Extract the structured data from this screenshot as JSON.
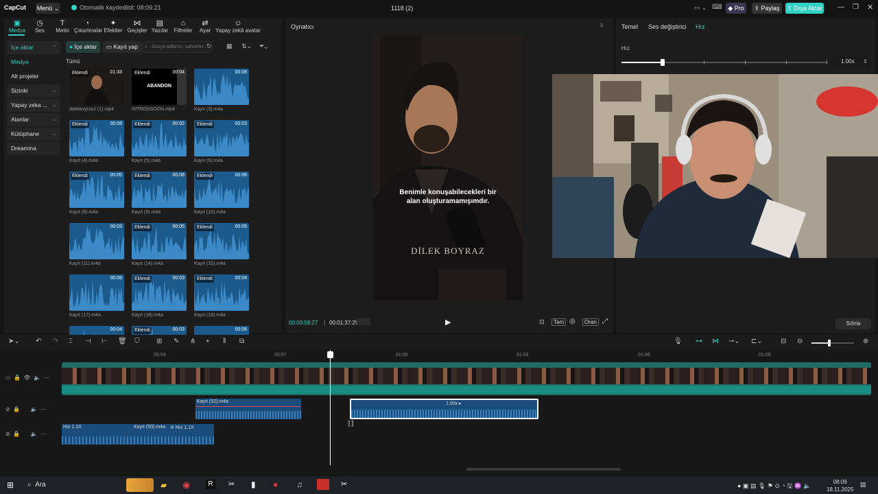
{
  "app": {
    "logo": "CapCut",
    "menu_label": "Menü",
    "autosave": "Otomatik kaydedildi: 08:09:21",
    "project_title": "1118 (2)",
    "pro_label": "Pro",
    "share_label": "Paylaş",
    "export_label": "Dışa Aktar",
    "accent_color": "#2fd1c4"
  },
  "media_tabs": [
    {
      "label": "Medya",
      "icon": "media-icon",
      "glyph": "▣",
      "active": true
    },
    {
      "label": "Ses",
      "icon": "audio-icon",
      "glyph": "◷"
    },
    {
      "label": "Metin",
      "icon": "text-icon",
      "glyph": "T"
    },
    {
      "label": "Çıkartmalar",
      "icon": "sticker-icon",
      "glyph": "◔"
    },
    {
      "label": "Efektler",
      "icon": "effects-icon",
      "glyph": "✦"
    },
    {
      "label": "Geçişler",
      "icon": "transitions-icon",
      "glyph": "⋈"
    },
    {
      "label": "Yazılar",
      "icon": "captions-icon",
      "glyph": "▤"
    },
    {
      "label": "Filtreler",
      "icon": "filters-icon",
      "glyph": "⌂"
    },
    {
      "label": "Ayar",
      "icon": "adjust-icon",
      "glyph": "⇄"
    },
    {
      "label": "Yapay zekâ avatar",
      "icon": "ai-avatar-icon",
      "glyph": "☺"
    }
  ],
  "sidebar": [
    {
      "label": "İçe aktar",
      "bg": true,
      "highlight": true,
      "chevron": "⌃"
    },
    {
      "label": "Medya",
      "bg": false,
      "highlight": true,
      "chevron": ""
    },
    {
      "label": "Alt projeler",
      "bg": false,
      "highlight": false,
      "chevron": ""
    },
    {
      "label": "Sizinki",
      "bg": true,
      "highlight": false,
      "chevron": "⌄"
    },
    {
      "label": "Yapay zeka ...",
      "bg": true,
      "highlight": false,
      "chevron": "⌄"
    },
    {
      "label": "Alanlar",
      "bg": true,
      "highlight": false,
      "chevron": "⌄"
    },
    {
      "label": "Kütüphane",
      "bg": true,
      "highlight": false,
      "chevron": "⌄"
    },
    {
      "label": "Dreamina",
      "bg": true,
      "highlight": false,
      "chevron": ""
    }
  ],
  "media_toolbar": {
    "import_label": "İçe aktar",
    "record_label": "Kayıt yap",
    "search_placeholder": "Dosya adlarını, sahneler..."
  },
  "media_section_title": "Tümü",
  "media_items": [
    {
      "name": "dilekboyrazz (1).mp4",
      "duration": "01:33",
      "added": "Eklendi",
      "kind": "video-person"
    },
    {
      "name": "İNTROSSOON.mp4",
      "duration": "00:04",
      "added": "Eklendi",
      "kind": "video-title",
      "title_text": "ABANDON"
    },
    {
      "name": "Kayıt (3).m4a",
      "duration": "00:08",
      "added": "",
      "kind": "audio"
    },
    {
      "name": "Kayıt (4).m4a",
      "duration": "00:08",
      "added": "Eklendi",
      "kind": "audio"
    },
    {
      "name": "Kayıt (5).m4a",
      "duration": "00:02",
      "added": "Eklendi",
      "kind": "audio"
    },
    {
      "name": "Kayıt (6).m4a",
      "duration": "00:03",
      "added": "Eklendi",
      "kind": "audio"
    },
    {
      "name": "Kayıt (8).m4a",
      "duration": "00:05",
      "added": "Eklendi",
      "kind": "audio"
    },
    {
      "name": "Kayıt (9).m4a",
      "duration": "00:08",
      "added": "Eklendi",
      "kind": "audio"
    },
    {
      "name": "Kayıt (10).m4a",
      "duration": "00:06",
      "added": "Eklendi",
      "kind": "audio"
    },
    {
      "name": "Kayıt (11).m4a",
      "duration": "00:03",
      "added": "",
      "kind": "audio"
    },
    {
      "name": "Kayıt (14).m4a",
      "duration": "00:05",
      "added": "Eklendi",
      "kind": "audio"
    },
    {
      "name": "Kayıt (15).m4a",
      "duration": "00:05",
      "added": "Eklendi",
      "kind": "audio"
    },
    {
      "name": "Kayıt (17).m4a",
      "duration": "00:08",
      "added": "",
      "kind": "audio"
    },
    {
      "name": "Kayıt (18).m4a",
      "duration": "00:03",
      "added": "Eklendi",
      "kind": "audio"
    },
    {
      "name": "Kayıt (19).m4a",
      "duration": "00:04",
      "added": "Eklendi",
      "kind": "audio"
    },
    {
      "name": "",
      "duration": "00:04",
      "added": "",
      "kind": "audio"
    },
    {
      "name": "",
      "duration": "00:03",
      "added": "Eklendi",
      "kind": "audio"
    },
    {
      "name": "",
      "duration": "00:06",
      "added": "",
      "kind": "audio"
    }
  ],
  "player": {
    "title": "Oynatıcı",
    "subtitle_line1": "Benimle konuşabilecekleri bir",
    "subtitle_line2": "alan oluşturamamışımdır.",
    "watermark": "DİLEK BOYRAZ",
    "current_time": "00:00:58:27",
    "total_time": "00:01:37:29",
    "full_label": "Tam",
    "ratio_label": "Oran"
  },
  "right_panel": {
    "tabs": [
      "Temel",
      "Ses değiştirici",
      "Hız"
    ],
    "active_tab": 2,
    "speed_label": "Hız",
    "speed_value": "1.00x",
    "reset_label": "Sıfırla"
  },
  "timeline": {
    "ruler": [
      "00:54",
      "00:57",
      "01:00",
      "01:03",
      "01:06",
      "01:09"
    ],
    "clip_a_label": "Kayıt (52).m4a",
    "clip_b_label": "1.00x",
    "clip_c1_label": "Hız 1.1X",
    "clip_c2_label": "Kayıt (50).m4a",
    "clip_c3_label": "Hız 1.1X"
  },
  "taskbar": {
    "search_label": "Ara",
    "time": "08:09",
    "date": "18.11.2025"
  }
}
